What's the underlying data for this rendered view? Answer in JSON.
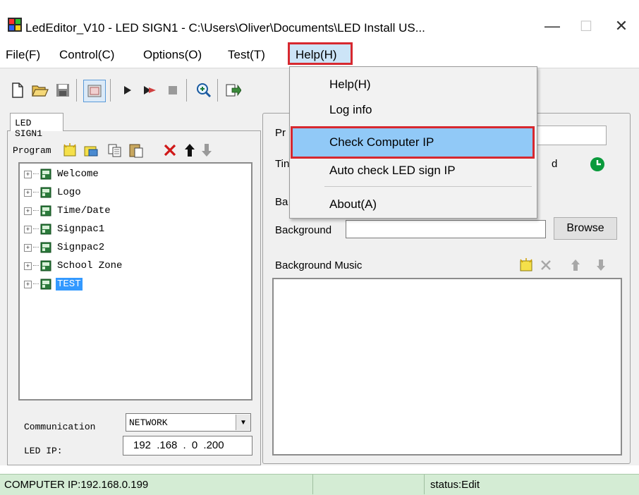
{
  "window": {
    "title": "LedEditor_V10 - LED SIGN1 - C:\\Users\\Oliver\\Documents\\LED Install US...",
    "minimize_glyph": "—",
    "maximize_glyph": "☐",
    "close_glyph": "✕"
  },
  "menubar": {
    "items": [
      "File(F)",
      "Control(C)",
      "Options(O)",
      "Test(T)",
      "Help(H)"
    ]
  },
  "help_menu": {
    "items": [
      "Help(H)",
      "Log info",
      "Check Computer IP",
      "Auto check LED sign IP",
      "About(A)"
    ],
    "highlighted": "Check Computer IP"
  },
  "left_panel": {
    "tab": "LED SIGN1",
    "program_label": "Program",
    "tree_items": [
      "Welcome",
      "Logo",
      "Time/Date",
      "Signpac1",
      "Signpac2",
      "School Zone",
      "TEST"
    ],
    "selected_item": "TEST",
    "communication_label": "Communication",
    "communication_value": "NETWORK",
    "led_ip_label": "LED IP:",
    "led_ip_value": "192 .168 . 0 .200"
  },
  "right_panel": {
    "program_label_fragment": "Pr",
    "time_label_fragment": "Tin",
    "time_right_fragment": "d",
    "bg_label_fragment": "Ba",
    "background_label": "Background",
    "browse_label": "Browse",
    "background_music_label": "Background Music"
  },
  "statusbar": {
    "computer_ip": "COMPUTER IP:192.168.0.199",
    "status": "status:Edit"
  },
  "colors": {
    "highlight_red": "#d7282f",
    "menu_hover": "#91c9f7",
    "selection": "#3399ff",
    "statusbar": "#d4ecd4",
    "clock_green": "#0a9a3c"
  }
}
